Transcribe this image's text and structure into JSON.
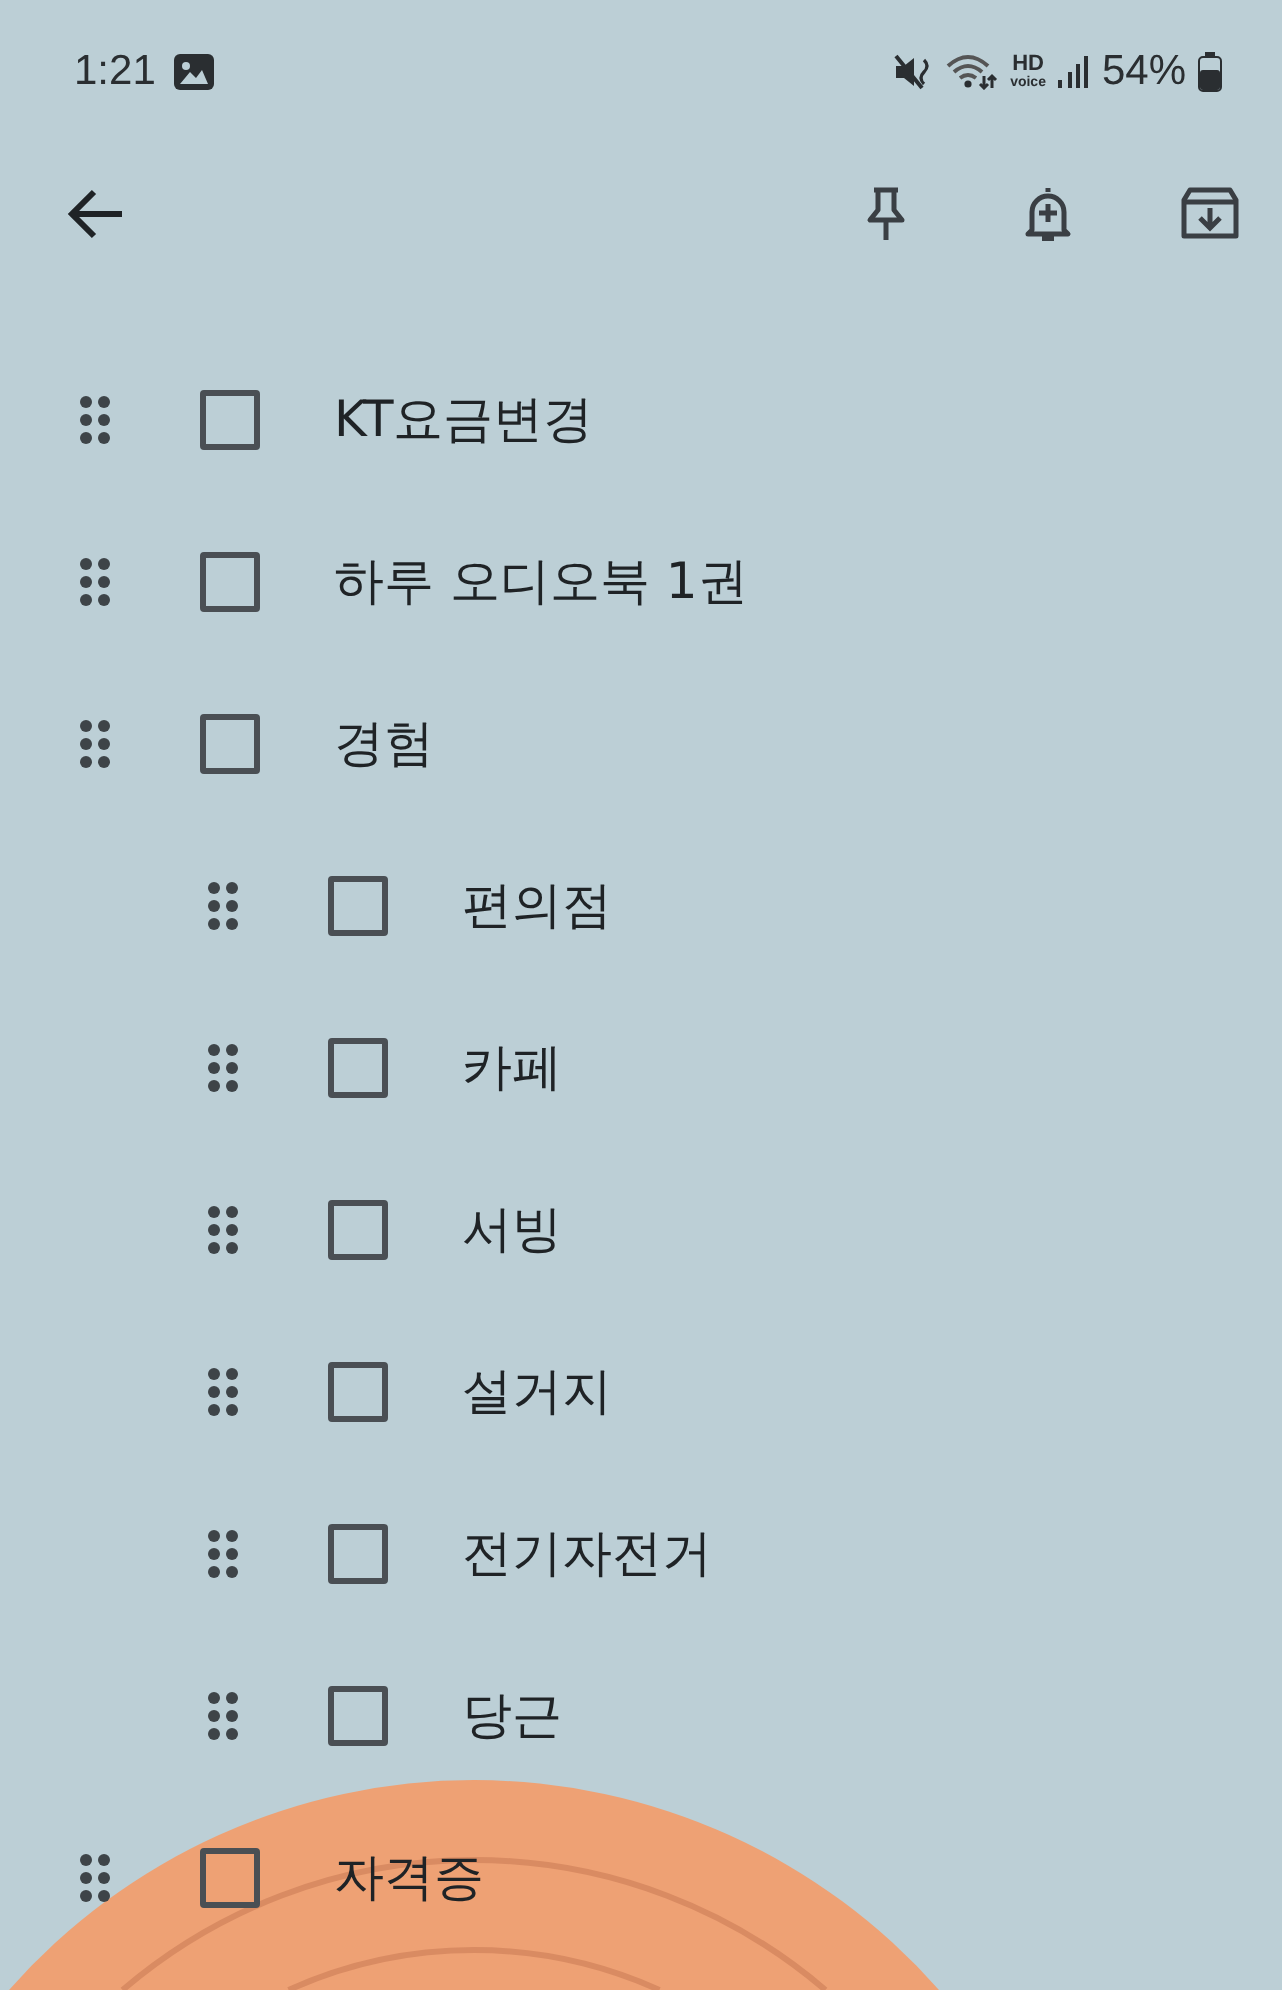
{
  "status_bar": {
    "time": "1:21",
    "hd": "HD",
    "voice": "voice",
    "battery": "54%"
  },
  "items": [
    {
      "text": "KT요금변경",
      "checked": false
    },
    {
      "text": "하루 오디오북 1권",
      "checked": false
    },
    {
      "text": "경험",
      "checked": false,
      "children": [
        {
          "text": "편의점",
          "checked": false
        },
        {
          "text": "카페",
          "checked": false
        },
        {
          "text": "서빙",
          "checked": false
        },
        {
          "text": "설거지",
          "checked": false
        },
        {
          "text": "전기자전거",
          "checked": false
        },
        {
          "text": "당근",
          "checked": false
        }
      ]
    },
    {
      "text": "자격증",
      "checked": false
    }
  ]
}
